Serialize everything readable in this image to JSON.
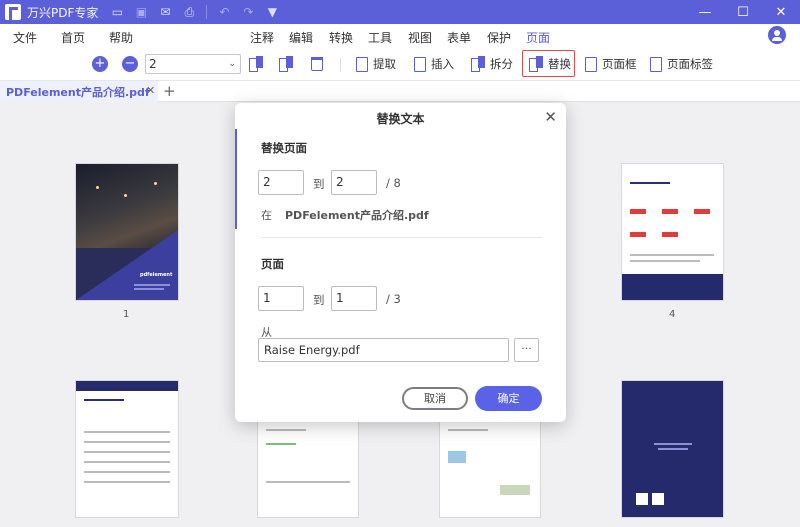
{
  "app": {
    "title": "万兴PDF专家",
    "window_controls": [
      "—",
      "☐",
      "✕"
    ]
  },
  "menu": {
    "left": [
      "文件",
      "首页",
      "帮助"
    ],
    "center": [
      "注释",
      "编辑",
      "转换",
      "工具",
      "视图",
      "表单",
      "保护",
      "页面"
    ],
    "active": "页面"
  },
  "toolbar": {
    "zoom_in": "+",
    "zoom_out": "−",
    "page_value": "2",
    "extract_label": "提取",
    "insert_label": "插入",
    "split_label": "拆分",
    "replace_label": "替换",
    "page_box_label": "页面框",
    "page_label_label": "页面标签"
  },
  "tabs": {
    "doc_name": "PDFelement产品介绍.pdf",
    "close": "✕",
    "add": "+"
  },
  "thumbnails": {
    "page_numbers": [
      "1",
      "4"
    ],
    "cover_brand": "pdfelement"
  },
  "dialog": {
    "title": "替换文本",
    "close": "✕",
    "replace_pages": {
      "title": "替换页面",
      "from": "2",
      "to_label": "到",
      "to": "2",
      "total": "/ 8",
      "in_label": "在",
      "file": "PDFelement产品介绍.pdf"
    },
    "pages": {
      "title": "页面",
      "from": "1",
      "to_label": "到",
      "to": "1",
      "total": "/ 3"
    },
    "from_label": "从",
    "source_file": "Raise Energy.pdf",
    "browse": "···",
    "cancel": "取消",
    "ok": "确定"
  }
}
